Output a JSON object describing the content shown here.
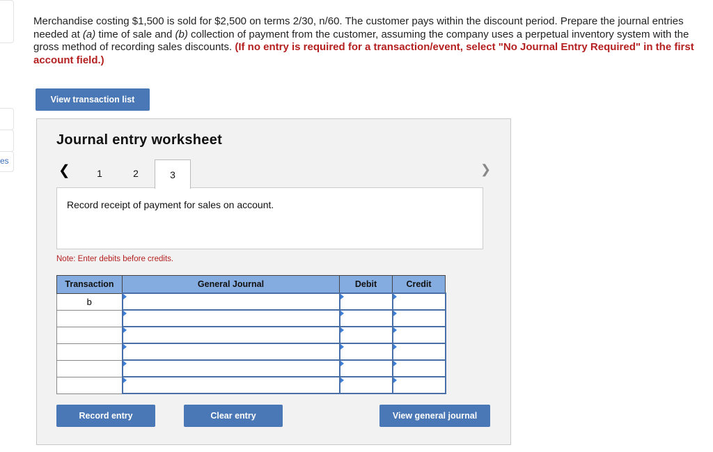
{
  "sidebar": {
    "fragment_label": "es"
  },
  "question": {
    "text_1": "Merchandise costing $1,500 is sold for $2,500 on terms 2/30, n/60. The customer pays within the discount period. Prepare the journal entries needed at ",
    "a": "(a)",
    "text_2": " time of sale and ",
    "b": "(b)",
    "text_3": " collection of payment from the customer, assuming the company uses a perpetual inventory system with the gross method of recording sales discounts. ",
    "instruction": "(If no entry is required for a transaction/event, select \"No Journal Entry Required\" in the first account field.)"
  },
  "view_transaction_list": "View transaction list",
  "worksheet": {
    "title": "Journal entry worksheet",
    "tabs": [
      "1",
      "2",
      "3"
    ],
    "active_tab": "3",
    "description": "Record receipt of payment for sales on account.",
    "note": "Note: Enter debits before credits.",
    "columns": [
      "Transaction",
      "General Journal",
      "Debit",
      "Credit"
    ],
    "rows": [
      {
        "transaction": "b",
        "account": "",
        "debit": "",
        "credit": ""
      },
      {
        "transaction": "",
        "account": "",
        "debit": "",
        "credit": ""
      },
      {
        "transaction": "",
        "account": "",
        "debit": "",
        "credit": ""
      },
      {
        "transaction": "",
        "account": "",
        "debit": "",
        "credit": ""
      },
      {
        "transaction": "",
        "account": "",
        "debit": "",
        "credit": ""
      },
      {
        "transaction": "",
        "account": "",
        "debit": "",
        "credit": ""
      }
    ],
    "buttons": {
      "record": "Record entry",
      "clear": "Clear entry",
      "view_journal": "View general journal"
    }
  },
  "colors": {
    "button": "#4a77b5",
    "header": "#85ace0",
    "red": "#b52020"
  }
}
